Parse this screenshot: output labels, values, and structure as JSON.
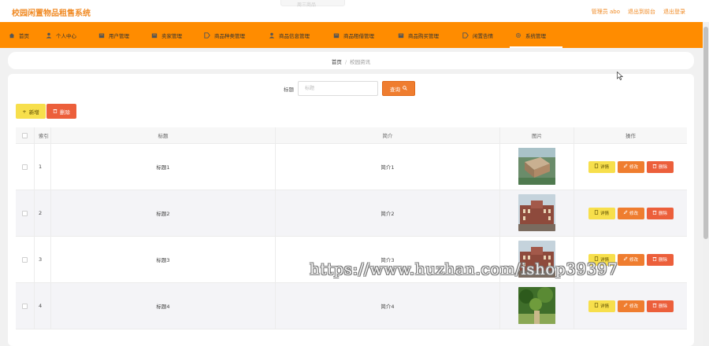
{
  "app": {
    "title": "校园闲置物品租售系统"
  },
  "top_search_ghost": "周三商品",
  "header": {
    "admin_label": "管理员 abo",
    "back_label": "退出到前台",
    "logout_label": "退出登录"
  },
  "nav": {
    "items": [
      {
        "label": "首页",
        "icon": "home-icon"
      },
      {
        "label": "个人中心",
        "icon": "user-icon"
      },
      {
        "label": "用户管理",
        "icon": "folder-icon"
      },
      {
        "label": "卖家管理",
        "icon": "folder-icon"
      },
      {
        "label": "商品种类管理",
        "icon": "tag-icon"
      },
      {
        "label": "商品信息管理",
        "icon": "user-icon"
      },
      {
        "label": "商品租借管理",
        "icon": "folder-icon"
      },
      {
        "label": "商品购买管理",
        "icon": "folder-icon"
      },
      {
        "label": "闲置告情",
        "icon": "tag-icon"
      },
      {
        "label": "系统管理",
        "icon": "gear-icon"
      }
    ],
    "active_index": 9
  },
  "breadcrumb": {
    "home": "首页",
    "separator": "/",
    "current": "校园资讯"
  },
  "search": {
    "label": "标题",
    "placeholder": "标题",
    "value": "",
    "query_label": "查询"
  },
  "actions": {
    "add_label": "新增",
    "delete_label": "删除"
  },
  "table": {
    "headers": {
      "index": "索引",
      "title": "标题",
      "intro": "简介",
      "image": "图片",
      "ops": "操作"
    },
    "rows": [
      {
        "index": "1",
        "title": "标题1",
        "intro": "简介1",
        "image": "campus-building-aerial"
      },
      {
        "index": "2",
        "title": "标题2",
        "intro": "简介2",
        "image": "red-brick-hall"
      },
      {
        "index": "3",
        "title": "标题3",
        "intro": "简介3",
        "image": "red-brick-hall"
      },
      {
        "index": "4",
        "title": "标题4",
        "intro": "简介4",
        "image": "green-park-trees"
      }
    ],
    "row_ops": {
      "detail": "详情",
      "edit": "修改",
      "remove": "删除"
    }
  },
  "watermark": "https://www.huzhan.com/ishop39397",
  "colors": {
    "accent": "#ff8c00",
    "title": "#f08a24",
    "yellow": "#f7df4c",
    "orange": "#ef7d2f",
    "red": "#ec5f3b"
  }
}
